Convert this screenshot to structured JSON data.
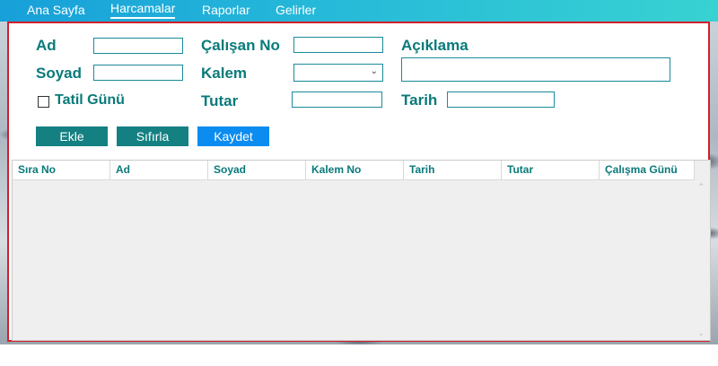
{
  "nav": {
    "items": [
      {
        "label": "Ana Sayfa"
      },
      {
        "label": "Harcamalar"
      },
      {
        "label": "Raporlar"
      },
      {
        "label": "Gelirler"
      }
    ],
    "active": "Harcamalar"
  },
  "form": {
    "ad_label": "Ad",
    "soyad_label": "Soyad",
    "tatil_label": "Tatil Günü",
    "calisan_no_label": "Çalışan No",
    "kalem_label": "Kalem",
    "tutar_label": "Tutar",
    "aciklama_label": "Açıklama",
    "tarih_label": "Tarih",
    "ad_value": "",
    "soyad_value": "",
    "calisan_no_value": "",
    "kalem_value": "",
    "tutar_value": "",
    "aciklama_value": "",
    "tarih_value": "",
    "tatil_checked": false
  },
  "buttons": {
    "ekle": "Ekle",
    "sifirla": "Sıfırla",
    "kaydet": "Kaydet"
  },
  "table": {
    "columns": [
      "Sıra No",
      "Ad",
      "Soyad",
      "Kalem No",
      "Tarih",
      "Tutar",
      "Çalışma Günü"
    ],
    "rows": []
  },
  "colors": {
    "nav_start": "#17a0d9",
    "nav_end": "#38d2d2",
    "label": "#0a7a7a",
    "panel_border": "#d21f2a",
    "button_teal": "#148082",
    "button_blue": "#0b8cf0"
  }
}
